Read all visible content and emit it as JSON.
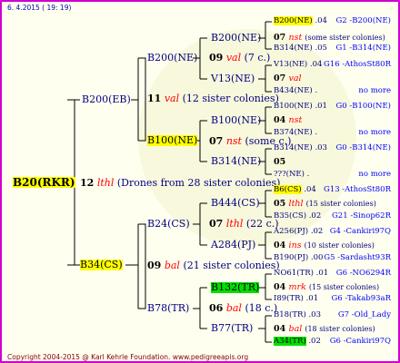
{
  "header": {
    "date": "6. 4.2015 ( 19: 19)"
  },
  "footer": {
    "copyright": "Copyright 2004-2015 @ Karl Kehrle Foundation.  www.pedigreeapis.org"
  },
  "colors": {
    "frame": "#d000d0",
    "label_blue": "#000080",
    "link_blue": "#0000ff",
    "red_italic": "#ff0000",
    "highlight_yellow": "#ffff00",
    "highlight_green": "#00e000"
  },
  "root": {
    "id": "B20(RKR)"
  },
  "root_mother": {
    "gen": "12",
    "name": "lthl",
    "note": "(Drones from 28 sister colonies)"
  },
  "queens": {
    "B200EB": "B200(EB)",
    "B34CS": "B34(CS)",
    "B200NE_a": "B200(NE)",
    "B100NE": "B100(NE)",
    "B24CS": "B24(CS)",
    "B78TR": "B78(TR)",
    "B200NE_b": "B200(NE)",
    "V13NE": "V13(NE)",
    "B100NE_b": "B100(NE)",
    "B314NE": "B314(NE)",
    "B444CS": "B444(CS)",
    "A284PJ": "A284(PJ)",
    "B132TR": "B132(TR)",
    "B77TR": "B77(TR)"
  },
  "drones": {
    "B200EB": {
      "gen": "11",
      "name": "val",
      "note": "(12 sister colonies)"
    },
    "B34CS": {
      "gen": "09",
      "name": "bal",
      "note": "(21 sister colonies)"
    },
    "B200NE_a": {
      "gen": "09",
      "name": "val",
      "note": "(7 c.)"
    },
    "B100NE": {
      "gen": "07",
      "name": "nst",
      "note": "(some c.)"
    },
    "B24CS": {
      "gen": "07",
      "name": "lthl",
      "note": "(22 c.)"
    },
    "B78TR": {
      "gen": "06",
      "name": "bal",
      "note": "(18 c.)"
    }
  },
  "right_column": [
    {
      "a": "B200(NE)",
      "a_hl": "y",
      "b": ".04",
      "c": "G2 -B200(NE)"
    },
    {
      "gen": "07",
      "name": "nst",
      "note": "(some sister colonies)"
    },
    {
      "a": "B314(NE)",
      "b": ".05",
      "c": "G1 -B314(NE)"
    },
    {
      "a": "V13(NE)",
      "b": ".04",
      "c": "G16 -AthosSt80R"
    },
    {
      "gen": "07",
      "name": "val",
      "note": ""
    },
    {
      "a": "B434(NE)",
      "b": ".",
      "c": "no more"
    },
    {
      "a": "B100(NE)",
      "b": ".01",
      "c": "G0 -B100(NE)"
    },
    {
      "gen": "04",
      "name": "nst",
      "note": ""
    },
    {
      "a": "B374(NE)",
      "b": ".",
      "c": "no more"
    },
    {
      "a": "B314(NE)",
      "b": ".03",
      "c": "G0 -B314(NE)"
    },
    {
      "gen": "05",
      "name": "",
      "note": ""
    },
    {
      "a": "???(NE)",
      "b": ".",
      "c": "no more"
    },
    {
      "a": "B6(CS)",
      "a_hl": "y",
      "b": ".04",
      "c": "G13 -AthosSt80R"
    },
    {
      "gen": "05",
      "name": "lthl",
      "note": "(15 sister colonies)"
    },
    {
      "a": "B35(CS)",
      "b": ".02",
      "c": "G21 -Sinop62R"
    },
    {
      "a": "A256(PJ)",
      "b": ".02",
      "c": "G4 -Cankiri97Q"
    },
    {
      "gen": "04",
      "name": "ins",
      "note": "(10 sister colonies)"
    },
    {
      "a": "B190(PJ)",
      "b": ".00",
      "c": "G5 -Sardasht93R"
    },
    {
      "a": "NO61(TR)",
      "b": ".01",
      "c": "G6 -NO6294R"
    },
    {
      "gen": "04",
      "name": "mrk",
      "note": "(15 sister colonies)"
    },
    {
      "a": "I89(TR)",
      "b": ".01",
      "c": "G6 -Takab93aR"
    },
    {
      "a": "B18(TR)",
      "b": ".03",
      "c": "G7 -Old_Lady"
    },
    {
      "gen": "04",
      "name": "bal",
      "note": "(18 sister colonies)"
    },
    {
      "a": "A34(TR)",
      "a_hl": "g",
      "b": ".02",
      "c": "G6 -Cankiri97Q"
    }
  ]
}
